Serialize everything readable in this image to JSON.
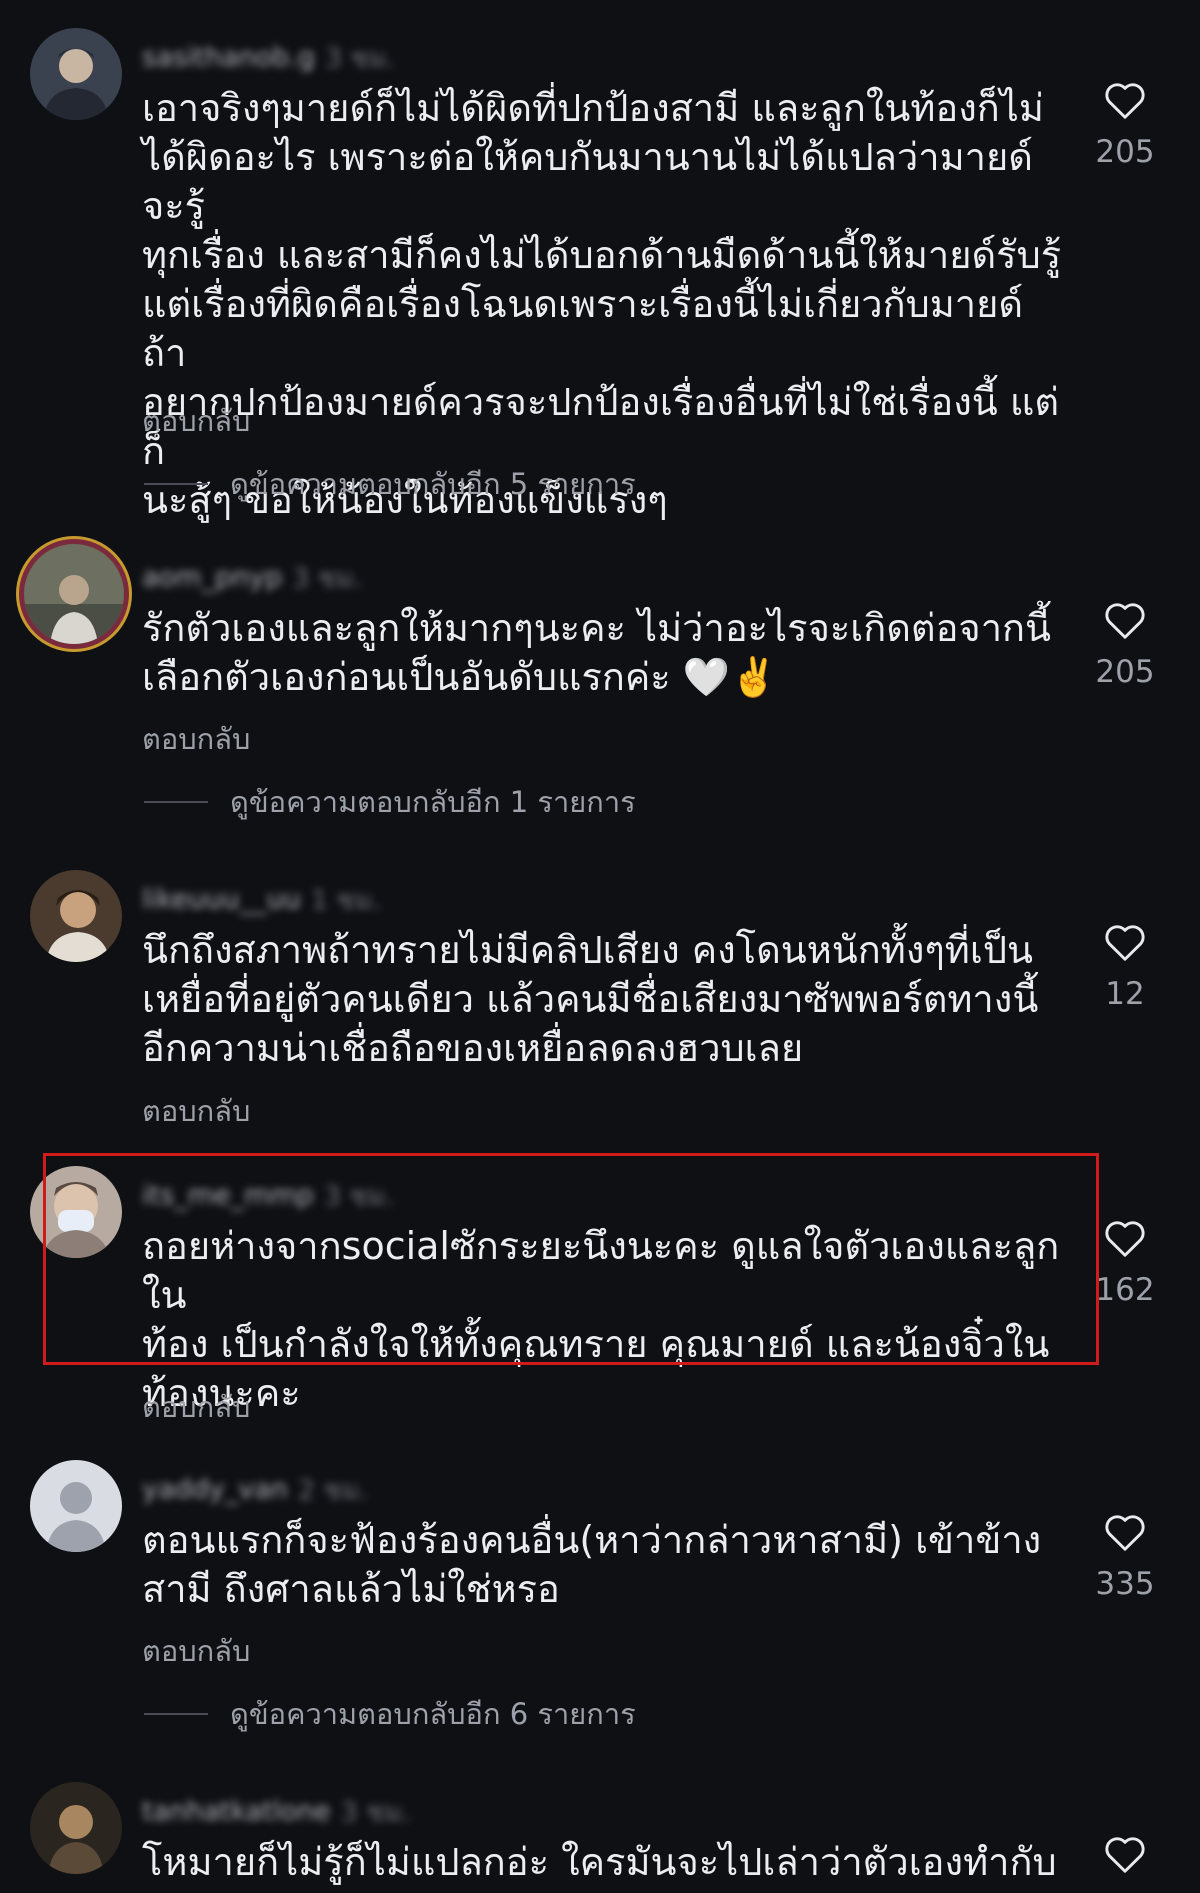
{
  "comments": [
    {
      "username": "sasithanob.g",
      "time": "3 ชม.",
      "text": "เอาจริงๆมายด์ก็ไม่ได้ผิดที่ปกป้องสามี และลูกในท้องก็ไม่\nได้ผิดอะไร เพราะต่อให้คบกันมานานไม่ได้แปลว่ามายด์จะรู้\nทุกเรื่อง และสามีก็คงไม่ได้บอกด้านมืดด้านนี้ให้มายด์รับรู้\nแต่เรื่องที่ผิดคือเรื่องโฉนดเพราะเรื่องนี้ไม่เกี่ยวกับมายด์ ถ้า\nอยากปกป้องมายด์ควรจะปกป้องเรื่องอื่นที่ไม่ใช่เรื่องนี้ แต่ก็\nนะสู้ๆ ขอให้น้องในท้องแข็งแรงๆ",
      "reply_label": "ตอบกลับ",
      "likes": "205",
      "view_replies": "ดูข้อความตอบกลับอีก 5 รายการ",
      "avatar_icon": "person-avatar-icon"
    },
    {
      "username": "aom_pnyp",
      "time": "3 ชม.",
      "text": "รักตัวเองและลูกให้มากๆนะคะ ไม่ว่าอะไรจะเกิดต่อจากนี้\nเลือกตัวเองก่อนเป็นอันดับแรกค่ะ 🤍✌️",
      "reply_label": "ตอบกลับ",
      "likes": "205",
      "view_replies": "ดูข้อความตอบกลับอีก 1 รายการ",
      "avatar_icon": "person-avatar-icon"
    },
    {
      "username": "likeuuu__uu",
      "time": "1 ชม.",
      "text": "นึกถึงสภาพถ้าทรายไม่มีคลิปเสียง คงโดนหนักทั้งๆที่เป็น\nเหยื่อที่อยู่ตัวคนเดียว แล้วคนมีชื่อเสียงมาซัพพอร์ตทางนี้\nอีกความน่าเชื่อถือของเหยื่อลดลงฮวบเลย",
      "reply_label": "ตอบกลับ",
      "likes": "12",
      "view_replies": "",
      "avatar_icon": "person-avatar-icon"
    },
    {
      "username": "its_me_mmp",
      "time": "3 ชม.",
      "text": "ถอยห่างจากsocialซักระยะนึงนะคะ ดูแลใจตัวเองและลูกใน\nท้อง เป็นกำลังใจให้ทั้งคุณทราย คุณมายด์  และน้องจิ๋วใน\nท้องนะคะ",
      "reply_label": "ตอบกลับ",
      "likes": "162",
      "view_replies": "",
      "avatar_icon": "person-avatar-icon"
    },
    {
      "username": "yaddy_van",
      "time": "2 ชม.",
      "text": "ตอนแรกก็จะฟ้องร้องคนอื่น(หาว่ากล่าวหาสามี) เข้าข้าง\nสามี ถึงศาลแล้วไม่ใช่หรอ",
      "reply_label": "ตอบกลับ",
      "likes": "335",
      "view_replies": "ดูข้อความตอบกลับอีก 6 รายการ",
      "avatar_icon": "default-avatar-icon"
    },
    {
      "username": "tanhatkatlone",
      "time": "3 ชม.",
      "text": "โหมายก็ไม่รู้ก็ไม่แปลกอ่ะ ใครมันจะไปเล่าว่าตัวเองทำกับ",
      "reply_label": "",
      "likes": "",
      "view_replies": "",
      "avatar_icon": "person-avatar-icon"
    }
  ],
  "colors": {
    "background": "#0e1014",
    "text": "#ecedef",
    "muted": "#9da1a9",
    "highlight_border": "#d11a1a"
  },
  "icons": {
    "like": "heart-outline-icon"
  }
}
